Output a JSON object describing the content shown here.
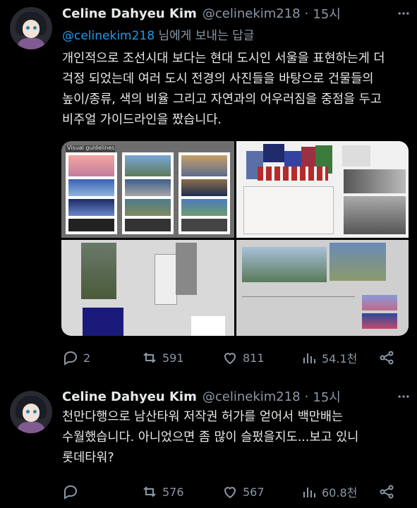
{
  "tweets": [
    {
      "author_name": "Celine Dahyeu Kim",
      "author_handle": "@celinekim218",
      "dot": "·",
      "time": "15시",
      "reply_mention": "@celinekim218",
      "reply_suffix": " 님에게 보내는 답글",
      "text": "개인적으로 조선시대 보다는 현대 도시인 서울을 표현하는게 더\n걱정 되었는데 여러 도시 전경의 사진들을 바탕으로 건물들의\n높이/종류, 색의 비율 그리고 자연과의 어우러짐을 중점을 두고\n비주얼 가이드라인을 짰습니다.",
      "media_label": "Visual guidelines",
      "counts": {
        "replies": "2",
        "reposts": "591",
        "likes": "811",
        "views": "54.1천"
      }
    },
    {
      "author_name": "Celine Dahyeu Kim",
      "author_handle": "@celinekim218",
      "dot": "·",
      "time": "15시",
      "text": "천만다행으로 남산타워 저작권 허가를 얻어서 백만배는\n수월했습니다. 아니었으면 좀 많이 슬펐을지도...보고 있니\n롯데타워?",
      "counts": {
        "replies": "",
        "reposts": "576",
        "likes": "567",
        "views": "60.8천"
      }
    }
  ],
  "icons": [
    "reply-icon",
    "repost-icon",
    "like-icon",
    "views-icon",
    "share-icon",
    "more-icon"
  ],
  "colors": {
    "background": "#000000",
    "text": "#e7e9ea",
    "muted": "#8b98a5",
    "link": "#1d9bf0"
  }
}
